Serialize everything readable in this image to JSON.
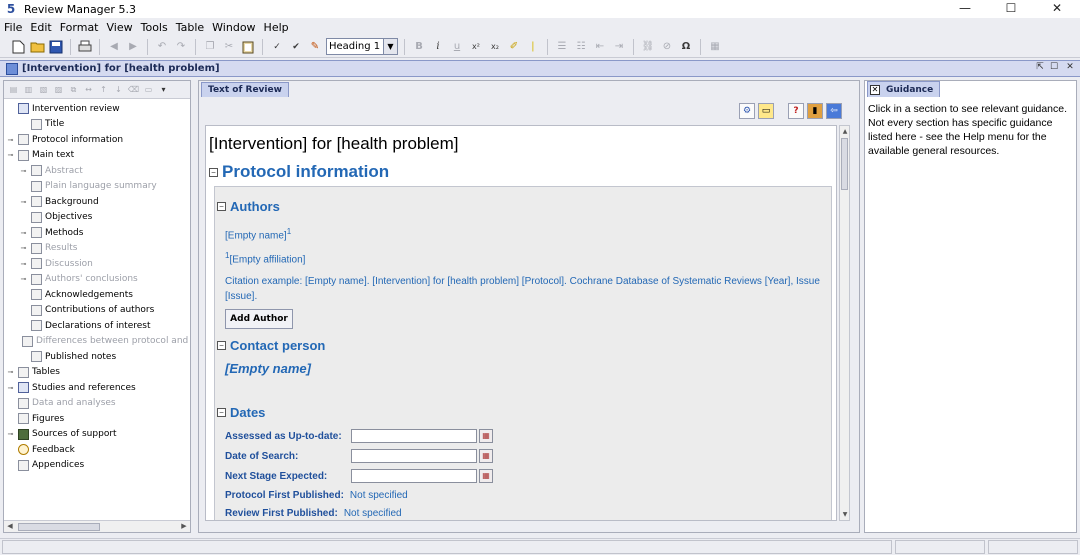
{
  "window": {
    "title": "Review Manager 5.3",
    "icon_char": "5",
    "minimize": "—",
    "maximize": "☐",
    "close": "✕"
  },
  "menu": [
    "File",
    "Edit",
    "Format",
    "View",
    "Tools",
    "Table",
    "Window",
    "Help"
  ],
  "toolbar": {
    "style_value": "Heading 1",
    "select_arrow": "▼"
  },
  "document": {
    "title": "[Intervention] for [health problem]"
  },
  "tree": {
    "items": [
      {
        "label": "Intervention review",
        "indent": 0,
        "expander": "",
        "icon": "book",
        "dim": false
      },
      {
        "label": "Title",
        "indent": 1,
        "expander": "",
        "icon": "page",
        "dim": false
      },
      {
        "label": "Protocol information",
        "indent": 0,
        "expander": "○-",
        "icon": "page",
        "dim": false
      },
      {
        "label": "Main text",
        "indent": 0,
        "expander": "○-",
        "icon": "page",
        "dim": false
      },
      {
        "label": "Abstract",
        "indent": 1,
        "expander": "○-",
        "icon": "page",
        "dim": true
      },
      {
        "label": "Plain language summary",
        "indent": 1,
        "expander": "",
        "icon": "page",
        "dim": true
      },
      {
        "label": "Background",
        "indent": 1,
        "expander": "○-",
        "icon": "page",
        "dim": false
      },
      {
        "label": "Objectives",
        "indent": 1,
        "expander": "",
        "icon": "page",
        "dim": false
      },
      {
        "label": "Methods",
        "indent": 1,
        "expander": "○-",
        "icon": "page",
        "dim": false
      },
      {
        "label": "Results",
        "indent": 1,
        "expander": "○-",
        "icon": "page",
        "dim": true
      },
      {
        "label": "Discussion",
        "indent": 1,
        "expander": "○-",
        "icon": "page",
        "dim": true
      },
      {
        "label": "Authors' conclusions",
        "indent": 1,
        "expander": "○-",
        "icon": "page",
        "dim": true
      },
      {
        "label": "Acknowledgements",
        "indent": 1,
        "expander": "",
        "icon": "page",
        "dim": false
      },
      {
        "label": "Contributions of authors",
        "indent": 1,
        "expander": "",
        "icon": "page",
        "dim": false
      },
      {
        "label": "Declarations of interest",
        "indent": 1,
        "expander": "",
        "icon": "page",
        "dim": false
      },
      {
        "label": "Differences between protocol and review",
        "indent": 1,
        "expander": "",
        "icon": "page",
        "dim": true
      },
      {
        "label": "Published notes",
        "indent": 1,
        "expander": "",
        "icon": "page",
        "dim": false
      },
      {
        "label": "Tables",
        "indent": 0,
        "expander": "○-",
        "icon": "table",
        "dim": false
      },
      {
        "label": "Studies and references",
        "indent": 0,
        "expander": "○-",
        "icon": "book",
        "dim": false
      },
      {
        "label": "Data and analyses",
        "indent": 0,
        "expander": "",
        "icon": "page",
        "dim": true
      },
      {
        "label": "Figures",
        "indent": 0,
        "expander": "",
        "icon": "page",
        "dim": false
      },
      {
        "label": "Sources of support",
        "indent": 0,
        "expander": "○-",
        "icon": "cam",
        "dim": false
      },
      {
        "label": "Feedback",
        "indent": 0,
        "expander": "",
        "icon": "q",
        "dim": false
      },
      {
        "label": "Appendices",
        "indent": 0,
        "expander": "",
        "icon": "page",
        "dim": false
      }
    ]
  },
  "editor": {
    "tab_label": "Text of Review",
    "protocol_heading": "Protocol information",
    "authors_heading": "Authors",
    "empty_name": "[Empty name]",
    "sup_one": "1",
    "empty_affiliation": "[Empty affiliation]",
    "citation_line1": "Citation example: [Empty name]. [Intervention] for [health problem] [Protocol]. Cochrane Database of Systematic Reviews [Year], Issue",
    "citation_line2": "[Issue].",
    "add_author_label": "Add Author",
    "contact_heading": "Contact person",
    "contact_empty_name": "[Empty name]",
    "dates_heading": "Dates",
    "date_fields": [
      {
        "label": "Assessed as Up-to-date:"
      },
      {
        "label": "Date of Search:"
      },
      {
        "label": "Next Stage Expected:"
      }
    ],
    "published_fields": [
      {
        "label": "Protocol First Published:",
        "value": "Not specified"
      },
      {
        "label": "Review First Published:",
        "value": "Not specified"
      }
    ],
    "collapse_glyph": "⊟"
  },
  "guidance": {
    "tab_label": "Guidance",
    "text": "Click in a section to see relevant guidance. Not every section has specific guidance listed here - see the Help menu for the available general resources."
  },
  "icons": {
    "new": "new-document-icon",
    "open": "open-folder-icon",
    "save": "save-icon",
    "print": "print-icon"
  },
  "colors": {
    "heading_blue": "#2368b5",
    "label_blue": "#1f4f9b",
    "tab_bg": "#c9d2ee"
  }
}
